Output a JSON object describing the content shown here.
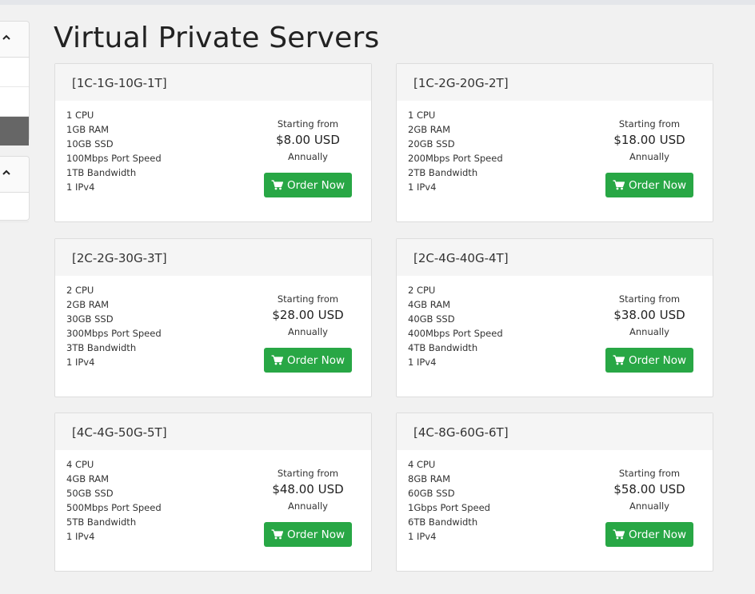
{
  "page": {
    "title": "Virtual Private Servers"
  },
  "products": [
    {
      "name": "[1C-1G-10G-1T]",
      "features": [
        "1 CPU",
        "1GB RAM",
        "10GB SSD",
        "100Mbps Port Speed",
        "1TB Bandwidth",
        "1 IPv4"
      ],
      "starting_label": "Starting from",
      "price": "$8.00 USD",
      "cycle": "Annually",
      "order_label": "Order Now"
    },
    {
      "name": "[1C-2G-20G-2T]",
      "features": [
        "1 CPU",
        "2GB RAM",
        "20GB SSD",
        "200Mbps Port Speed",
        "2TB Bandwidth",
        "1 IPv4"
      ],
      "starting_label": "Starting from",
      "price": "$18.00 USD",
      "cycle": "Annually",
      "order_label": "Order Now"
    },
    {
      "name": "[2C-2G-30G-3T]",
      "features": [
        "2 CPU",
        "2GB RAM",
        "30GB SSD",
        "300Mbps Port Speed",
        "3TB Bandwidth",
        "1 IPv4"
      ],
      "starting_label": "Starting from",
      "price": "$28.00 USD",
      "cycle": "Annually",
      "order_label": "Order Now"
    },
    {
      "name": "[2C-4G-40G-4T]",
      "features": [
        "2 CPU",
        "4GB RAM",
        "40GB SSD",
        "400Mbps Port Speed",
        "4TB Bandwidth",
        "1 IPv4"
      ],
      "starting_label": "Starting from",
      "price": "$38.00 USD",
      "cycle": "Annually",
      "order_label": "Order Now"
    },
    {
      "name": "[4C-4G-50G-5T]",
      "features": [
        "4 CPU",
        "4GB RAM",
        "50GB SSD",
        "500Mbps Port Speed",
        "5TB Bandwidth",
        "1 IPv4"
      ],
      "starting_label": "Starting from",
      "price": "$48.00 USD",
      "cycle": "Annually",
      "order_label": "Order Now"
    },
    {
      "name": "[4C-8G-60G-6T]",
      "features": [
        "4 CPU",
        "8GB RAM",
        "60GB SSD",
        "1Gbps Port Speed",
        "6TB Bandwidth",
        "1 IPv4"
      ],
      "starting_label": "Starting from",
      "price": "$58.00 USD",
      "cycle": "Annually",
      "order_label": "Order Now"
    }
  ],
  "icons": {
    "order": "shopping-cart-icon",
    "sidebar_toggle": "chevron-up-icon"
  },
  "colors": {
    "order_button": "#28a745",
    "background": "#f1f1f1",
    "card_header": "#f5f5f5"
  }
}
